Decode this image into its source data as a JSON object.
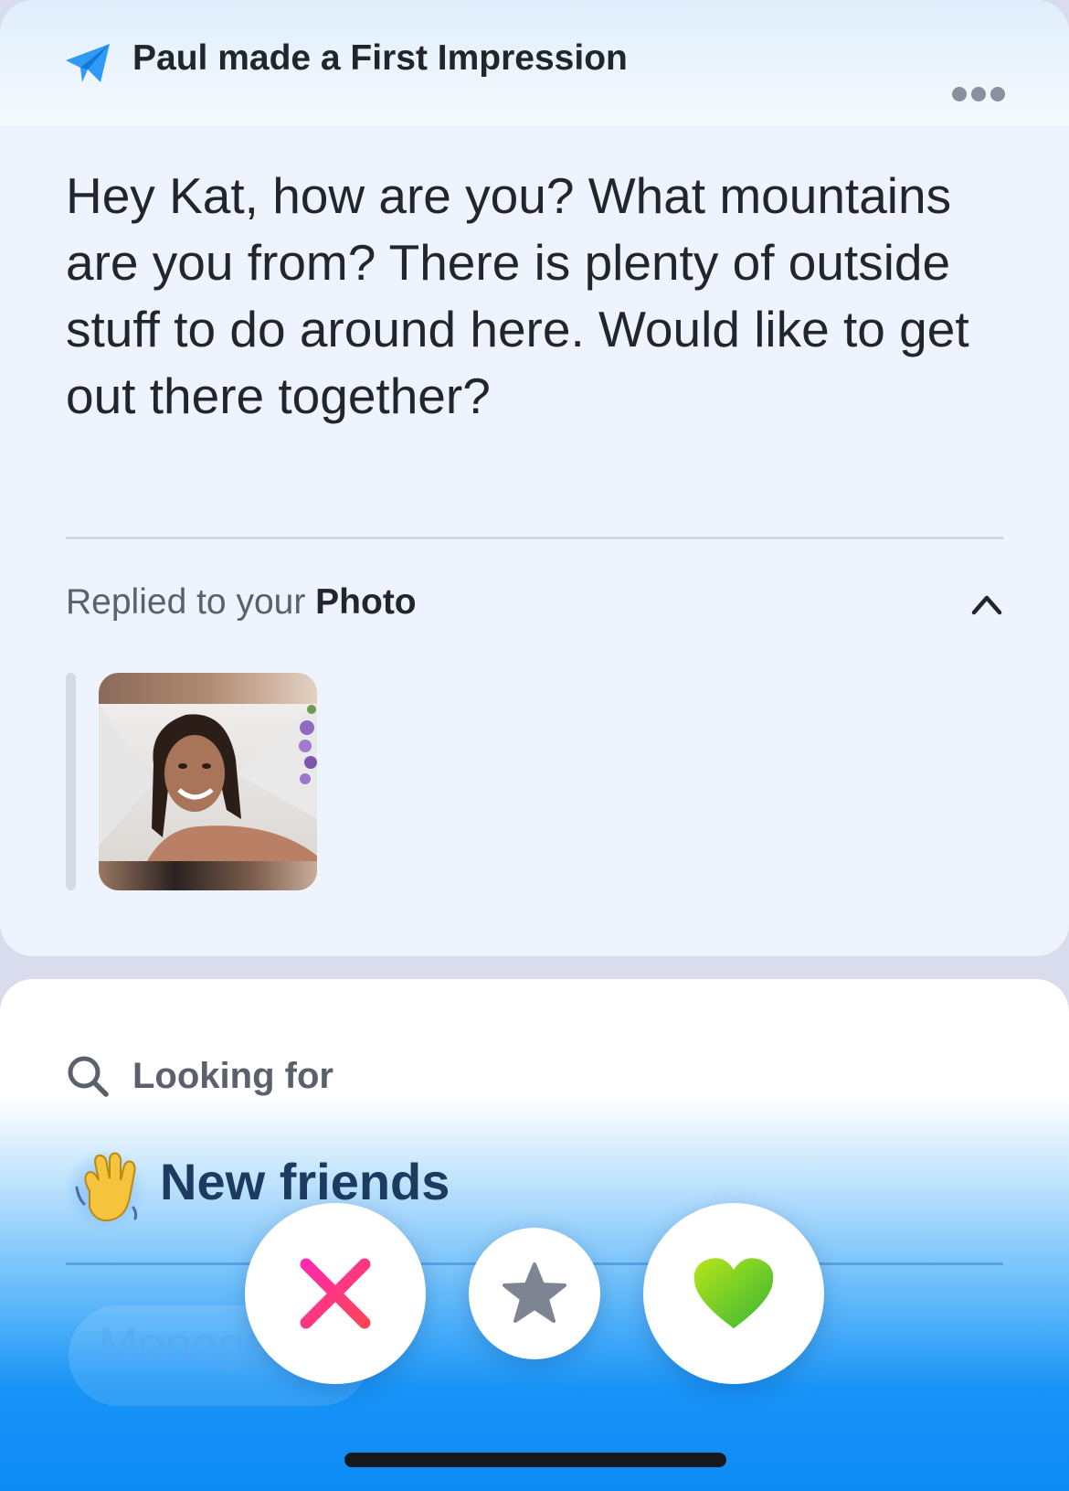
{
  "header": {
    "title": "Paul made a First Impression",
    "icon": "paper-plane-icon",
    "more_icon": "ellipsis-icon"
  },
  "message": {
    "text": "Hey Kat, how are you? What mountains are you from? There is plenty of outside stuff to do around here. Would like to get out there together?"
  },
  "reply": {
    "prefix": "Replied to your ",
    "target": "Photo",
    "toggle_icon": "chevron-up-icon"
  },
  "profile": {
    "looking_for_label": "Looking for",
    "looking_for_value": "New friends",
    "value_emoji": "waving-hand-icon",
    "next_item_partial": "Monoga"
  },
  "actions": {
    "nope_icon": "x-icon",
    "super_like_icon": "star-icon",
    "like_icon": "heart-icon"
  },
  "colors": {
    "accent_blue": "#1893f6",
    "nope_pink": "#fd267a",
    "like_green": "#6fcb2b",
    "text_dark": "#21252c"
  }
}
